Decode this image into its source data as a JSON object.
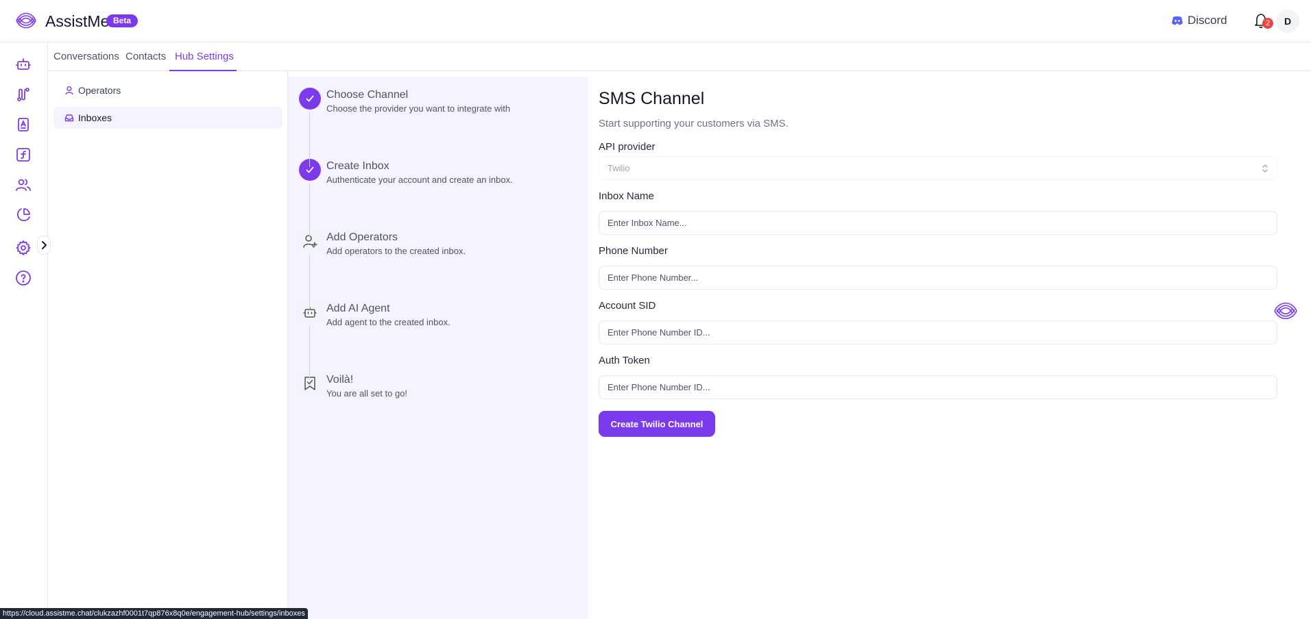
{
  "header": {
    "app_name": "AssistMe",
    "badge": "Beta",
    "discord_label": "Discord",
    "notification_count": "2",
    "avatar_initial": "D"
  },
  "rail": {
    "icons": [
      "bot-icon",
      "flow-icon",
      "contact-book-icon",
      "function-icon",
      "users-icon",
      "pie-chart-icon",
      "gear-icon",
      "help-icon"
    ]
  },
  "tabs": [
    {
      "label": "Conversations",
      "active": false
    },
    {
      "label": "Contacts",
      "active": false
    },
    {
      "label": "Hub Settings",
      "active": true
    }
  ],
  "subnav": [
    {
      "label": "Operators",
      "icon": "user-icon",
      "active": false
    },
    {
      "label": "Inboxes",
      "icon": "inbox-icon",
      "active": true
    }
  ],
  "steps": [
    {
      "title": "Choose Channel",
      "desc": "Choose the provider you want to integrate with",
      "status": "done"
    },
    {
      "title": "Create Inbox",
      "desc": "Authenticate your account and create an inbox.",
      "status": "done"
    },
    {
      "title": "Add Operators",
      "desc": "Add operators to the created inbox.",
      "status": "todo",
      "icon": "user-plus-icon"
    },
    {
      "title": "Add AI Agent",
      "desc": "Add agent to the created inbox.",
      "status": "todo",
      "icon": "bot-icon"
    },
    {
      "title": "Voilà!",
      "desc": "You are all set to go!",
      "status": "todo",
      "icon": "bookmark-check-icon"
    }
  ],
  "form": {
    "title": "SMS Channel",
    "subtitle": "Start supporting your customers via SMS.",
    "provider_label": "API provider",
    "provider_value": "Twilio",
    "inbox_name_label": "Inbox Name",
    "inbox_name_placeholder": "Enter Inbox Name...",
    "phone_label": "Phone Number",
    "phone_placeholder": "Enter Phone Number...",
    "sid_label": "Account SID",
    "sid_placeholder": "Enter Phone Number ID...",
    "token_label": "Auth Token",
    "token_placeholder": "Enter Phone Number ID...",
    "submit_label": "Create Twilio Channel"
  },
  "status_bar": {
    "url": "https://cloud.assistme.chat/clukzazhf0001t7qp876x8q0e/engagement-hub/settings/inboxes"
  },
  "colors": {
    "accent": "#7c3aed",
    "stepper_bg": "#f5f3ff",
    "badge_red": "#ef4444"
  }
}
